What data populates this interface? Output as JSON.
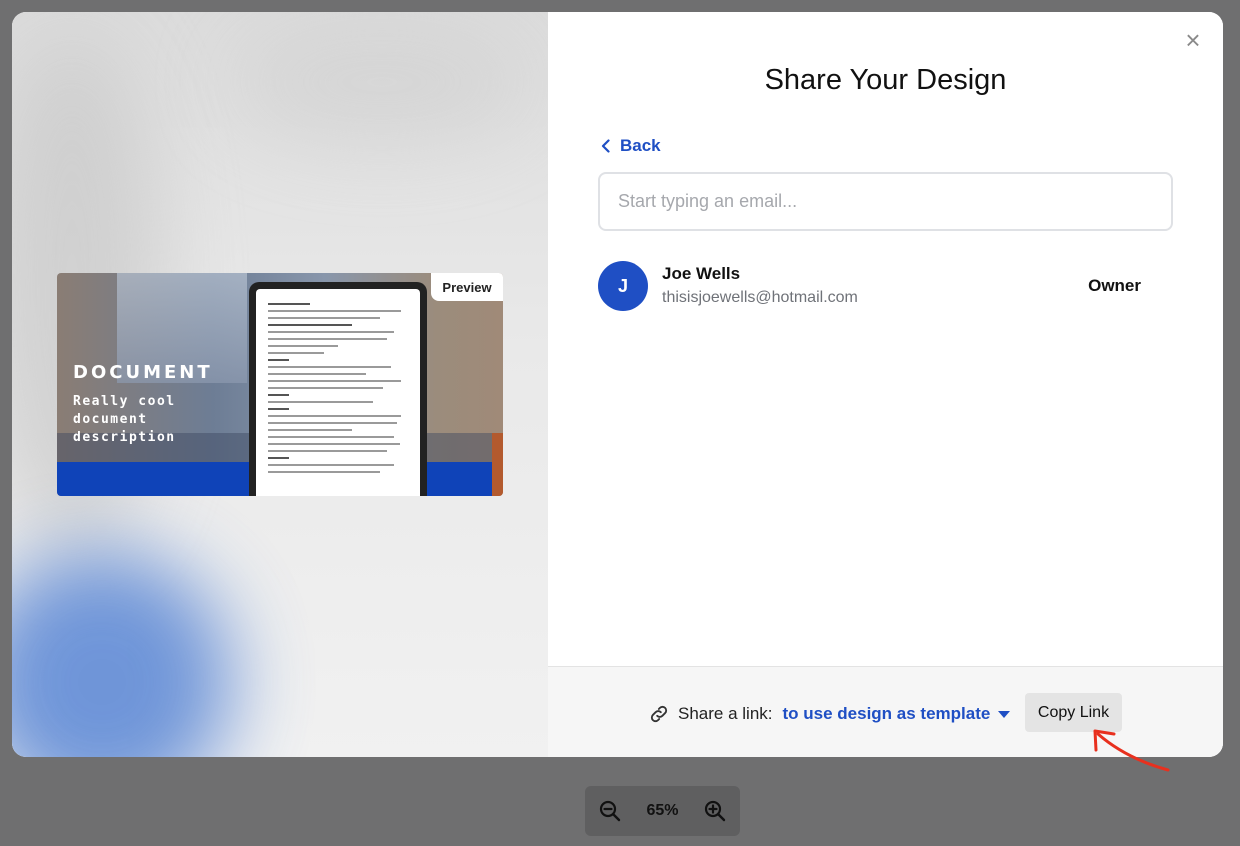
{
  "modal": {
    "title": "Share Your Design",
    "close_label": "×",
    "back_label": "Back",
    "email_input": {
      "placeholder": "Start typing an email...",
      "value": ""
    }
  },
  "preview": {
    "badge": "Preview",
    "doc_title": "DOCUMENT",
    "doc_description": "Really cool document description"
  },
  "members": [
    {
      "initial": "J",
      "name": "Joe Wells",
      "email": "thisisjoewells@hotmail.com",
      "role": "Owner"
    }
  ],
  "share_link": {
    "label": "Share a link:",
    "mode": "to use design as template",
    "copy_button": "Copy Link"
  },
  "zoom": {
    "value": "65%"
  },
  "colors": {
    "accent": "#1f4fc4",
    "annotation": "#e8301e"
  }
}
